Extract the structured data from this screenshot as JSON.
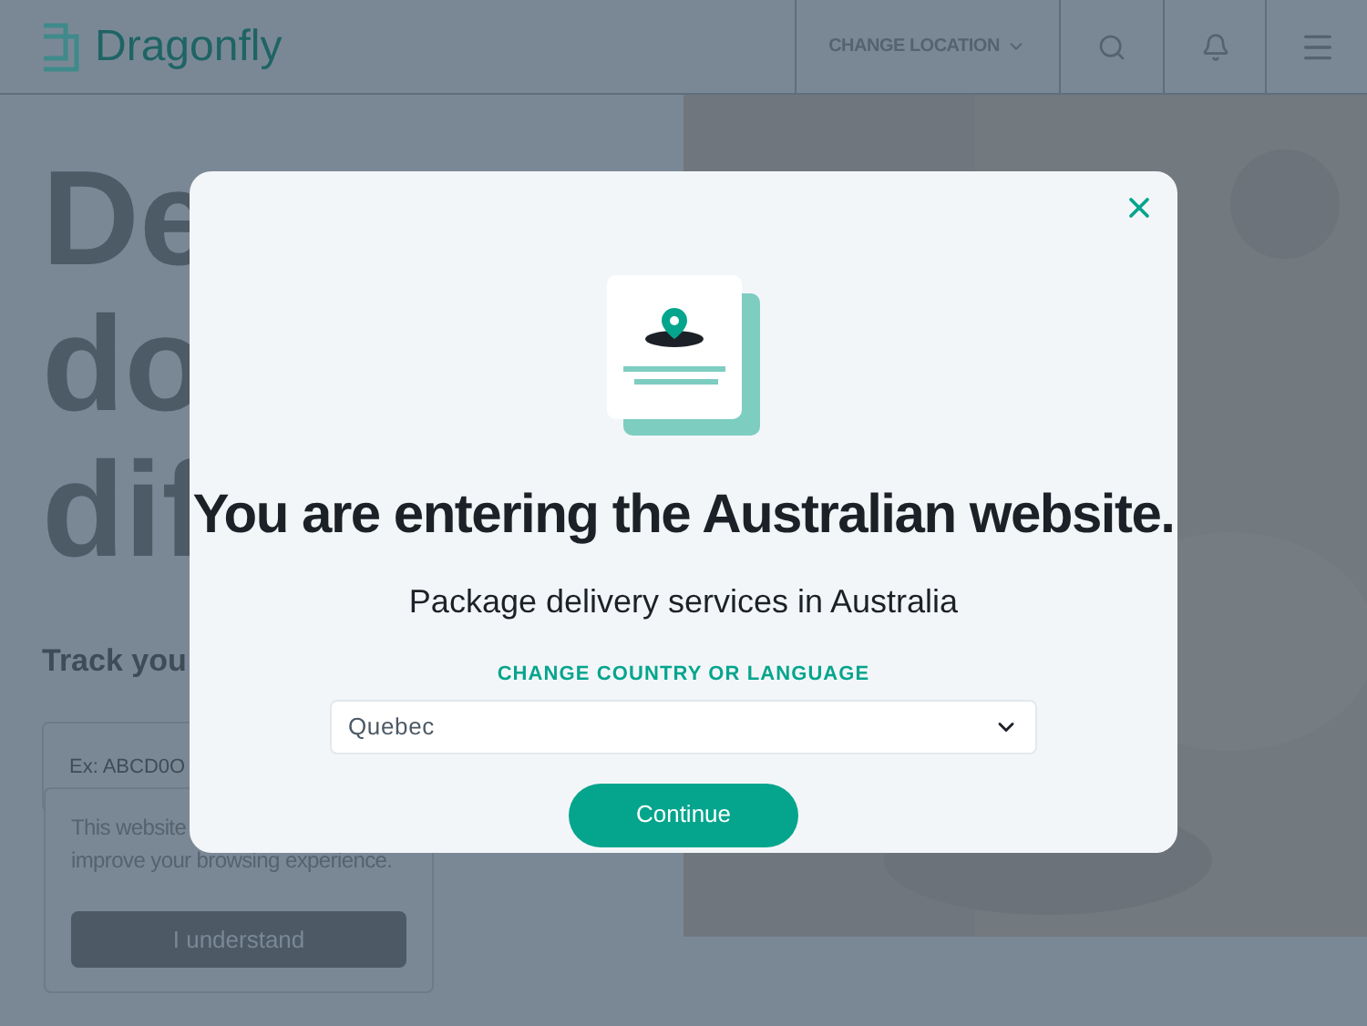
{
  "header": {
    "logo": "Dragonfly",
    "location_button": "CHANGE LOCATION"
  },
  "hero": {
    "heading_lines": [
      "De",
      "do",
      "dif"
    ],
    "track_title": "Track you",
    "tracking_field": {
      "placeholder": "Ex: ABCD0O"
    }
  },
  "cookie_notice": {
    "text_lines": [
      "This website",
      "improve your browsing experience."
    ],
    "button": "I understand"
  },
  "modal": {
    "title": "You are entering the Australian website.",
    "subtitle": "Package delivery services in Australia",
    "select_label": "CHANGE COUNTRY OR LANGUAGE",
    "select": {
      "value": "Quebec"
    },
    "button": "Continue"
  }
}
